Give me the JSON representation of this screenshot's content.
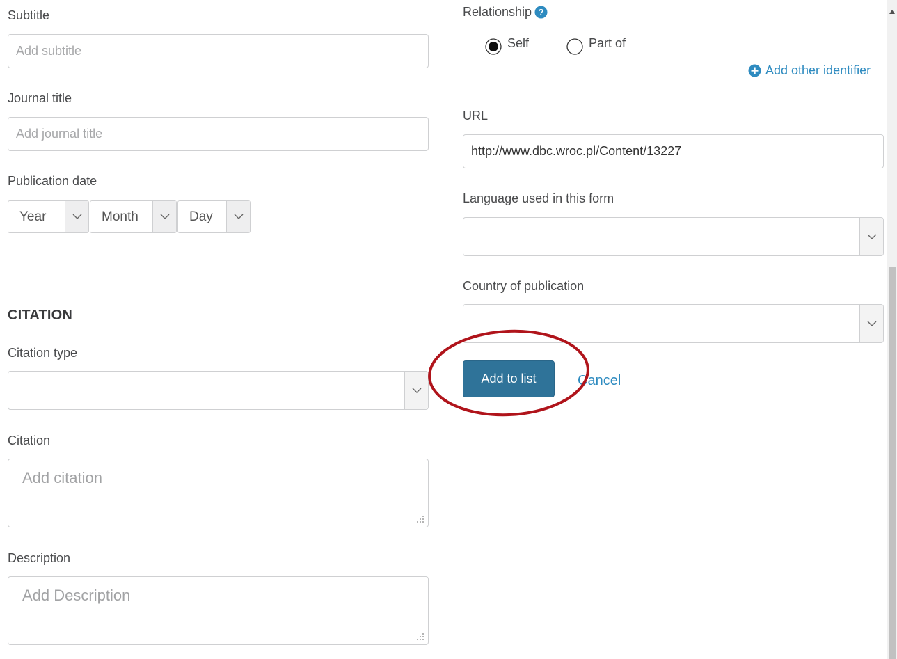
{
  "left": {
    "subtitle": {
      "label": "Subtitle",
      "placeholder": "Add subtitle"
    },
    "journal_title": {
      "label": "Journal title",
      "placeholder": "Add journal title"
    },
    "publication_date": {
      "label": "Publication date",
      "year": "Year",
      "month": "Month",
      "day": "Day"
    },
    "citation_heading": "CITATION",
    "citation_type": {
      "label": "Citation type",
      "value": ""
    },
    "citation": {
      "label": "Citation",
      "placeholder": "Add citation"
    },
    "description": {
      "label": "Description",
      "placeholder": "Add Description"
    }
  },
  "right": {
    "relationship": {
      "label": "Relationship",
      "help_icon": "question-circle-icon",
      "options": [
        {
          "label": "Self",
          "selected": true
        },
        {
          "label": "Part of",
          "selected": false
        }
      ]
    },
    "add_identifier": {
      "label": "Add other identifier",
      "icon": "plus-circle-icon"
    },
    "url": {
      "label": "URL",
      "value": "http://www.dbc.wroc.pl/Content/13227"
    },
    "language": {
      "label": "Language used in this form",
      "value": ""
    },
    "country": {
      "label": "Country of publication",
      "value": ""
    },
    "actions": {
      "add_label": "Add to list",
      "cancel_label": "Cancel"
    }
  },
  "colors": {
    "primary_button": "#2f7399",
    "link": "#2e8bc0",
    "highlight_circle": "#b0141b"
  }
}
